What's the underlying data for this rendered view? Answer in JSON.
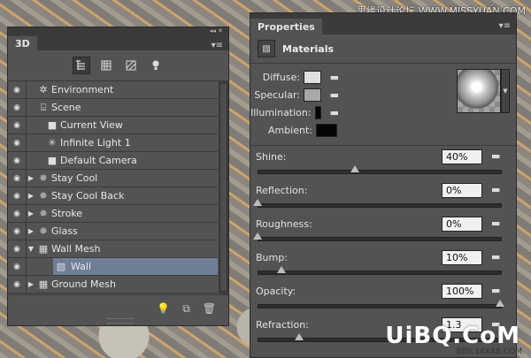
{
  "watermark_top": "思缘设计论坛 WWW.MISSYUAN.COM",
  "watermark_bottom": "BBS.16XX8.COM",
  "logo": "UiBQ.CoM",
  "panel3d": {
    "tab": "3D",
    "collapse": "◂◂ ✕",
    "menu": "▾≡",
    "rows": [
      {
        "label": "Environment"
      },
      {
        "label": "Scene"
      },
      {
        "label": "Current View"
      },
      {
        "label": "Infinite Light 1"
      },
      {
        "label": "Default Camera"
      },
      {
        "label": "Stay  Cool"
      },
      {
        "label": "Stay  Cool Back"
      },
      {
        "label": "Stroke"
      },
      {
        "label": "Glass"
      },
      {
        "label": "Wall Mesh"
      },
      {
        "label": "Wall"
      },
      {
        "label": "Ground Mesh"
      }
    ]
  },
  "properties": {
    "tab": "Properties",
    "menu": "▾≡",
    "section_title": "Materials",
    "colors": [
      {
        "label": "Diffuse:",
        "color": "#e0e0e0"
      },
      {
        "label": "Specular:",
        "color": "#a8a8a8"
      },
      {
        "label": "Illumination:",
        "color": "#050505"
      },
      {
        "label": "Ambient:",
        "color": "#050505"
      }
    ],
    "sliders": [
      {
        "label": "Shine:",
        "value": "40%",
        "level": 0.4
      },
      {
        "label": "Reflection:",
        "value": "0%",
        "level": 0.0
      },
      {
        "label": "Roughness:",
        "value": "0%",
        "level": 0.0
      },
      {
        "label": "Bump:",
        "value": "10%",
        "level": 0.1
      },
      {
        "label": "Opacity:",
        "value": "100%",
        "level": 1.0
      },
      {
        "label": "Refraction:",
        "value": "1.3",
        "level": 0.17
      }
    ]
  }
}
